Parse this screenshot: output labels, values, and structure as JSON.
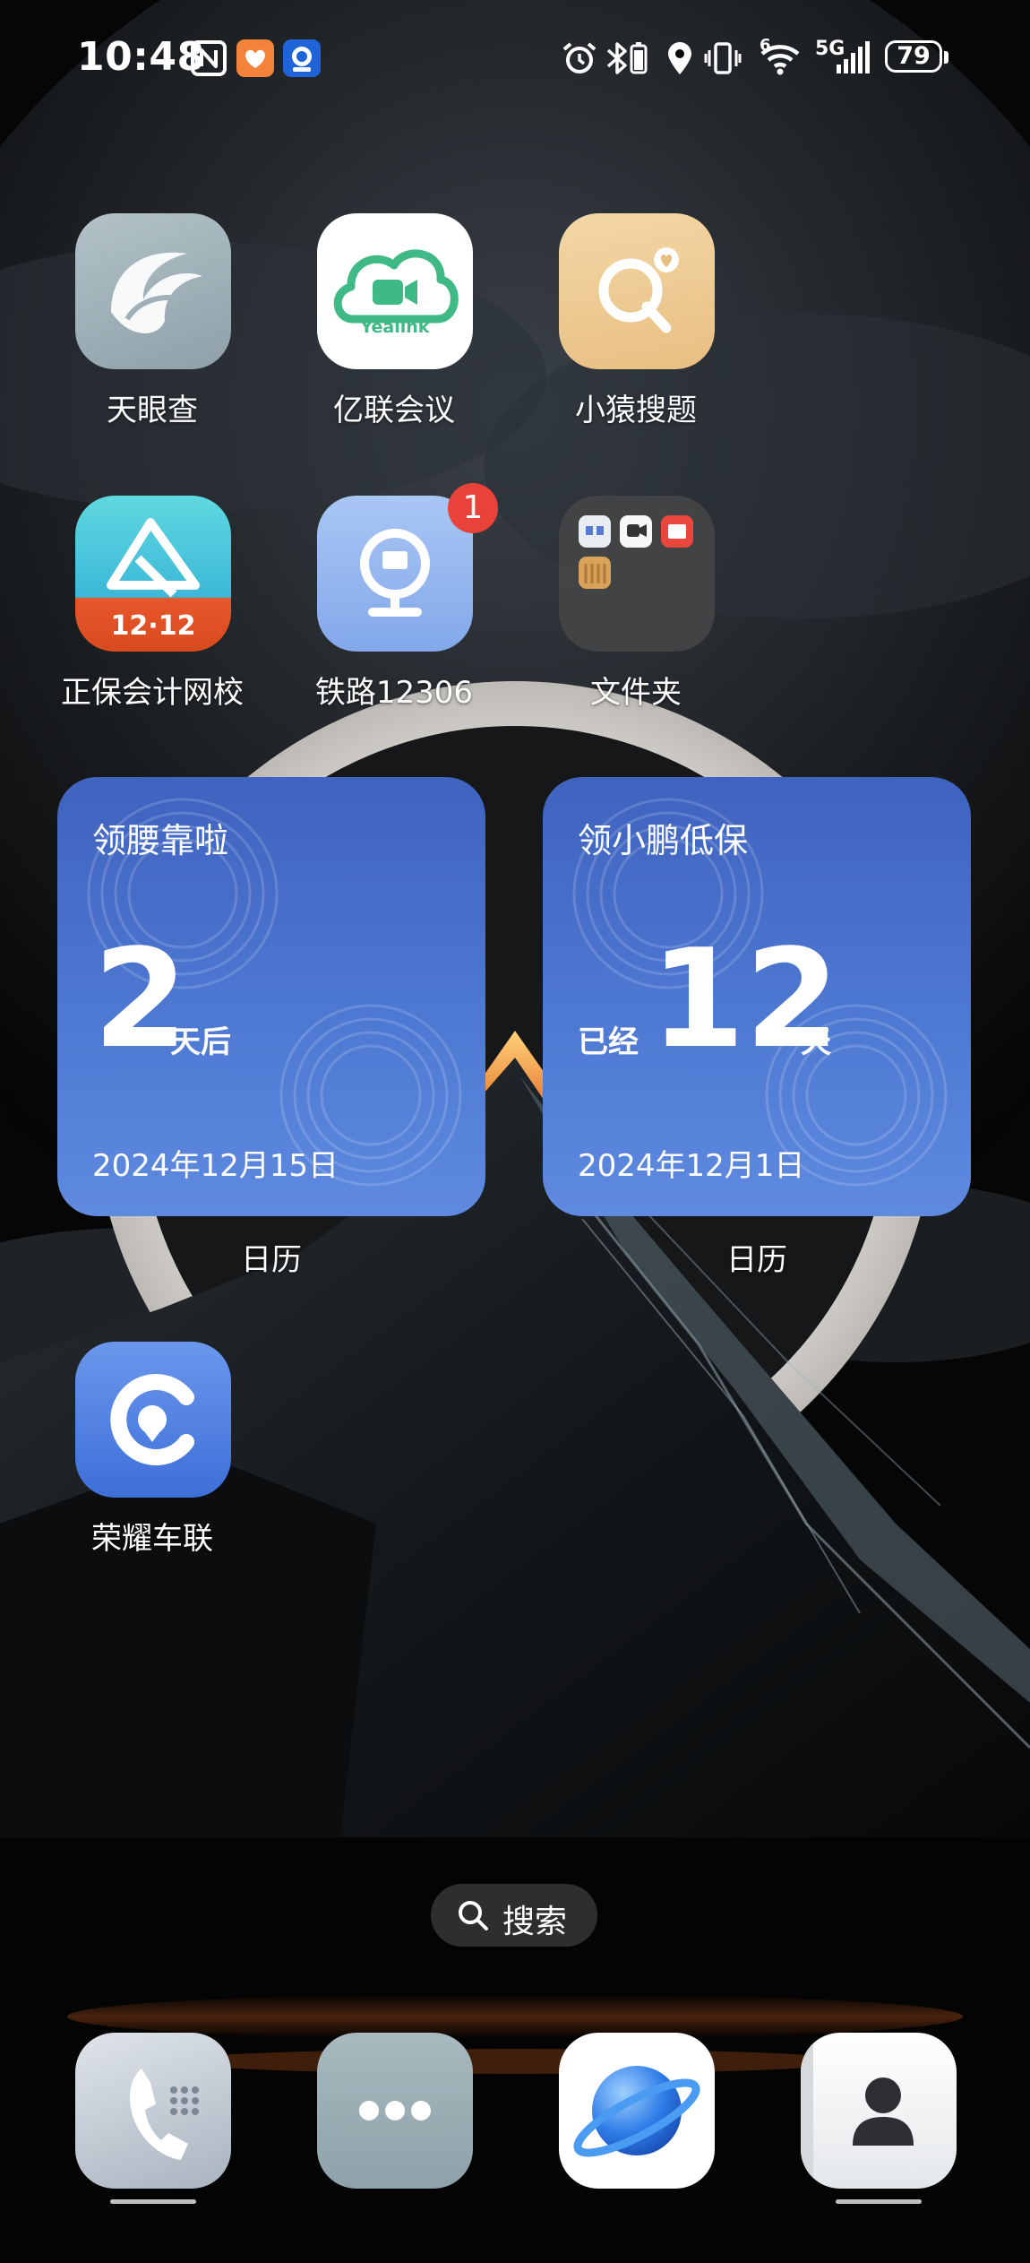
{
  "status_bar": {
    "time": "10:48",
    "network_label": "5G",
    "wifi_label": "6",
    "battery_percent": "79",
    "icons": [
      "nfc-icon",
      "notification-app-orange-icon",
      "notification-app-blue-icon",
      "alarm-icon",
      "bluetooth-icon",
      "location-icon",
      "vibrate-icon",
      "wifi-icon",
      "signal-icon",
      "battery-icon"
    ]
  },
  "apps": [
    {
      "id": "tianyancha",
      "label": "天眼查",
      "icon": "tianyancha-icon"
    },
    {
      "id": "yealink",
      "label": "亿联会议",
      "icon": "yealink-cloud-icon",
      "brand": "Yealink"
    },
    {
      "id": "xiaoyuan",
      "label": "小猿搜题",
      "icon": "search-question-icon"
    },
    {
      "id": "zhengbao",
      "label": "正保会计网校",
      "icon": "zhengbao-icon",
      "promo": "12·12"
    },
    {
      "id": "railway",
      "label": "铁路12306",
      "icon": "railway-icon",
      "badge": "1"
    },
    {
      "id": "folder",
      "label": "文件夹",
      "icon": "folder-icon"
    },
    {
      "id": "honor-car",
      "label": "荣耀车联",
      "icon": "honor-car-icon"
    }
  ],
  "widgets": [
    {
      "title": "领腰靠啦",
      "number": "2",
      "suffix": "天后",
      "prefix": "",
      "date": "2024年12月15日",
      "label": "日历"
    },
    {
      "title": "领小鹏低保",
      "number": "12",
      "suffix": "天",
      "prefix": "已经",
      "date": "2024年12月1日",
      "label": "日历"
    }
  ],
  "search": {
    "label": "搜索"
  },
  "dock": [
    {
      "id": "phone",
      "icon": "phone-icon"
    },
    {
      "id": "messages",
      "icon": "messages-icon"
    },
    {
      "id": "browser",
      "icon": "browser-planet-icon"
    },
    {
      "id": "contacts",
      "icon": "contacts-icon"
    }
  ],
  "colors": {
    "widget_blue": "#4a70cc",
    "badge_red": "#e8423a",
    "yealink_green": "#3fba86",
    "xiaoyuan_gold": "#efc98f"
  }
}
